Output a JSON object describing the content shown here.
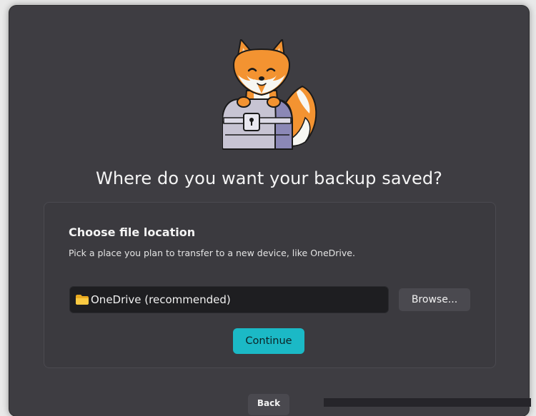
{
  "dialog": {
    "heading": "Where do you want your backup saved?",
    "mascot_icon": "fox-with-chest-icon"
  },
  "card": {
    "title": "Choose file location",
    "description": "Pick a place you plan to transfer to a new device, like OneDrive.",
    "location": {
      "icon": "folder-icon",
      "value": "OneDrive (recommended)"
    },
    "browse_label": "Browse...",
    "continue_label": "Continue"
  },
  "footer": {
    "back_label": "Back"
  },
  "colors": {
    "background": "#3e3d42",
    "accent": "#1bb9c6",
    "field": "#1e1e21",
    "secondary_button": "#4a494f"
  }
}
